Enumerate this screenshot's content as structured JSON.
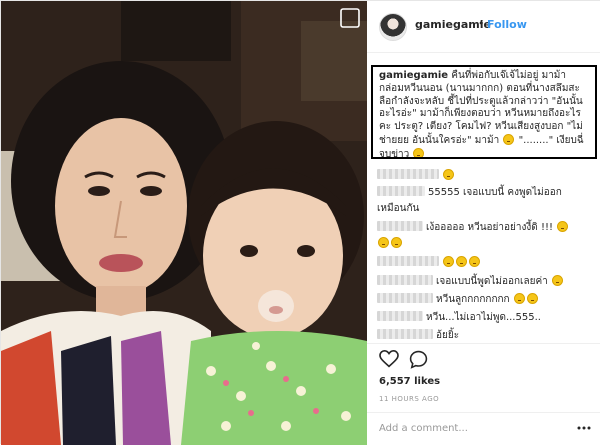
{
  "header": {
    "username": "gamiegamie",
    "separator": "•",
    "follow_label": "Follow",
    "avatar_icon": "profile-avatar"
  },
  "caption": {
    "username": "gamiegamie",
    "text": "คืนที่พ่อกับเจ๊เจ้ไม่อยู่ มาม้ากล่อมหวีนนอน (นานมากกก) ตอนที่นางสลึมสะลือกำลังจะหลับ ชี้ไปที่ประตูแล้วกล่าวว่า \"อันนั้นอะไรอ่ะ\" มาม้าก็เพียงตอบว่า หวีนหมายถึงอะไรคะ ประตู? เตียง? โคมไฟ? หวีนเสียงสูงบอก \"ไม่ช่ายยย อันนั้นใครอ่ะ\" มาม้า",
    "text_end": "\"........\" เงียบฉี่จบข่าว"
  },
  "comments": [
    {
      "text": "",
      "emoji": "weary-face",
      "blur_width": 62
    },
    {
      "text": "55555 เจอแบบนี้ คงพูดไม่ออก",
      "emoji": "",
      "blur_width": 48
    },
    {
      "text": "เหมือนกัน",
      "emoji": "",
      "blur_width": 0
    },
    {
      "text": "เง้อออออ หวีนอย่าอย่างงี้ดิ !!!",
      "emoji": "scream-face",
      "blur_width": 46
    },
    {
      "text": "",
      "emoji": "scream-faces",
      "blur_width": 0
    },
    {
      "text": "",
      "emoji": "grin-faces",
      "blur_width": 62
    },
    {
      "text": "เจอแบบนี้พูดไม่ออกเลยค่า",
      "emoji": "sweat-face",
      "blur_width": 56
    },
    {
      "text": "หวีนลูกกกกกกกก",
      "emoji": "cry-faces",
      "blur_width": 56
    },
    {
      "text": "หวีน...ไม่เอาไม่พูด...555..",
      "emoji": "",
      "blur_width": 46
    },
    {
      "text": "อ้ยยิ้ะ",
      "emoji": "",
      "blur_width": 56
    }
  ],
  "actions": {
    "like_icon": "heart-icon",
    "comment_icon": "comment-bubble-icon"
  },
  "likes": "6,557 likes",
  "timestamp": "11 HOURS AGO",
  "add_comment": {
    "placeholder": "Add a comment...",
    "more_icon": "more-options-icon"
  },
  "colors": {
    "follow_blue": "#3897f0",
    "caption_border": "#000000",
    "muted_text": "#999999"
  }
}
